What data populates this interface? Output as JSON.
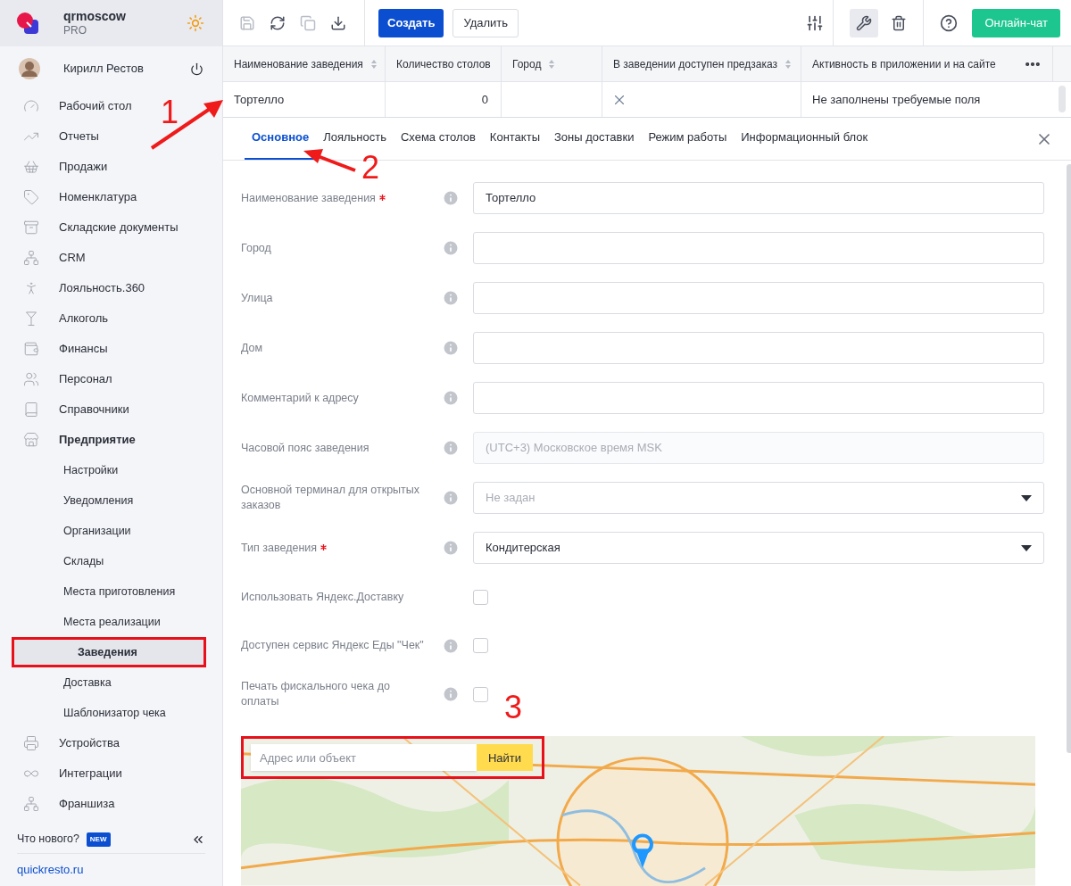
{
  "brand": {
    "name": "qrmoscow",
    "plan": "PRO"
  },
  "user": {
    "name": "Кирилл Рестов"
  },
  "sidebar": {
    "items": [
      {
        "label": "Рабочий стол"
      },
      {
        "label": "Отчеты"
      },
      {
        "label": "Продажи"
      },
      {
        "label": "Номенклатура"
      },
      {
        "label": "Складские документы"
      },
      {
        "label": "CRM"
      },
      {
        "label": "Лояльность.360"
      },
      {
        "label": "Алкоголь"
      },
      {
        "label": "Финансы"
      },
      {
        "label": "Персонал"
      },
      {
        "label": "Справочники"
      },
      {
        "label": "Предприятие",
        "expanded": true,
        "children": [
          {
            "label": "Настройки",
            "selected": false,
            "annotated": false
          },
          {
            "label": "Уведомления",
            "selected": false,
            "annotated": false
          },
          {
            "label": "Организации",
            "selected": false,
            "annotated": false
          },
          {
            "label": "Склады",
            "selected": false,
            "annotated": false
          },
          {
            "label": "Места приготовления",
            "selected": false,
            "annotated": false
          },
          {
            "label": "Места реализации",
            "selected": false,
            "annotated": false
          },
          {
            "label": "Заведения",
            "selected": true,
            "annotated": true
          },
          {
            "label": "Доставка",
            "selected": false,
            "annotated": false
          },
          {
            "label": "Шаблонизатор чека",
            "selected": false,
            "annotated": false
          }
        ]
      },
      {
        "label": "Устройства"
      },
      {
        "label": "Интеграции"
      },
      {
        "label": "Франшиза"
      }
    ],
    "whats_new": "Что нового?",
    "new_badge": "NEW",
    "site_link": "quickresto.ru"
  },
  "toolbar": {
    "buttons": [
      {
        "label": "Создать",
        "kind": "primary"
      },
      {
        "label": "Удалить",
        "kind": "secondary"
      }
    ],
    "chat_button": "Онлайн-чат"
  },
  "table": {
    "columns": [
      {
        "label": "Наименование заведения",
        "sortable": true
      },
      {
        "label": "Количество столов",
        "sortable": false
      },
      {
        "label": "Город",
        "sortable": true
      },
      {
        "label": "В заведении доступен предзаказ",
        "sortable": true
      },
      {
        "label": "Активность в приложении и на сайте",
        "sortable": false
      }
    ],
    "rows": [
      {
        "name": "Тортелло",
        "tables": "0",
        "preorder": false,
        "activity": "Не заполнены требуемые поля"
      }
    ]
  },
  "tabs": [
    {
      "label": "Основное",
      "selected": true
    },
    {
      "label": "Лояльность",
      "selected": false
    },
    {
      "label": "Схема столов",
      "selected": false
    },
    {
      "label": "Контакты",
      "selected": false
    },
    {
      "label": "Зоны доставки",
      "selected": false
    },
    {
      "label": "Режим работы",
      "selected": false
    },
    {
      "label": "Информационный блок",
      "selected": false
    }
  ],
  "form": [
    {
      "kind": "text",
      "label": "Наименование заведения",
      "required": true,
      "info": true,
      "value": "Тортелло"
    },
    {
      "kind": "text",
      "label": "Город",
      "required": false,
      "info": true
    },
    {
      "kind": "text",
      "label": "Улица",
      "required": false,
      "info": true
    },
    {
      "kind": "text",
      "label": "Дом",
      "required": false,
      "info": true
    },
    {
      "kind": "text",
      "label": "Комментарий к адресу",
      "required": false,
      "info": true
    },
    {
      "kind": "text",
      "label": "Часовой пояс заведения",
      "required": false,
      "info": true,
      "disabled": true,
      "value": "(UTC+3) Московское время MSK"
    },
    {
      "kind": "select",
      "label": "Основной терминал для открытых заказов",
      "required": false,
      "info": true,
      "placeholder": "Не задан"
    },
    {
      "kind": "select",
      "label": "Тип заведения",
      "required": true,
      "info": true,
      "value": "Кондитерская"
    },
    {
      "kind": "checkbox",
      "label": "Использовать Яндекс.Доставку",
      "required": false,
      "info": false,
      "checked": false
    },
    {
      "kind": "checkbox",
      "label": "Доступен сервис Яндекс Еды \"Чек\"",
      "required": false,
      "info": true,
      "checked": false
    },
    {
      "kind": "checkbox",
      "label": "Печать фискального чека до оплаты",
      "required": false,
      "info": true,
      "checked": false
    }
  ],
  "map": {
    "kind": "picture",
    "search": {
      "placeholder": "Адрес или объект",
      "annotated": true
    },
    "search_button": "Найти"
  },
  "annotations": [
    {
      "label": "1"
    },
    {
      "label": "2"
    },
    {
      "label": "3"
    }
  ]
}
